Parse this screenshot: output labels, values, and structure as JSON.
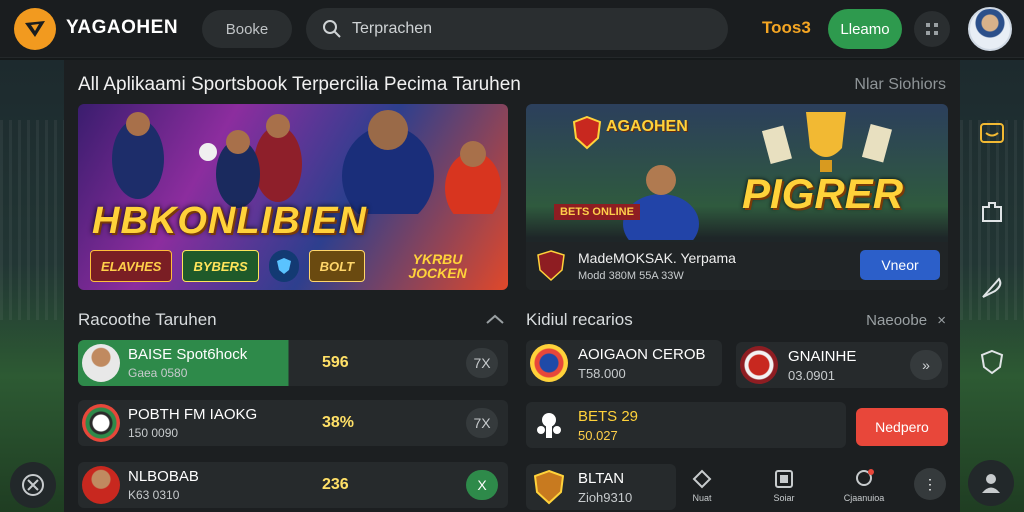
{
  "header": {
    "brand": "YAGAOHEN",
    "books_label": "Booke",
    "search_placeholder": "Terprachen",
    "odds_label": "Toos3",
    "login_label": "Lleamo"
  },
  "main": {
    "title": "All Aplikaami Sportsbook Terpercilia Pecima Taruhen",
    "top_link": "Nlar Siohiors",
    "banner_left": {
      "headline": "HBKONLIBIEN",
      "badges": [
        "ELAVHES",
        "BYBERS",
        "YKRBU JOCKEN"
      ],
      "badge_logo": "BOLT"
    },
    "banner_right": {
      "logo": "AGAOHEN",
      "headline": "PIGRER",
      "stripe": "BETS ONLINE",
      "title": "MadeMOKSAK. Yerpama",
      "subtitle": "Modd 380M 55A 33W",
      "button": "Vneor"
    },
    "left_section": {
      "title": "Racoothe Taruhen",
      "rows": [
        {
          "name": "BAISE Spot6hock",
          "sub": "Gaea 0580",
          "odds": "596",
          "action": "7X",
          "active": true
        },
        {
          "name": "POBTH FM IAOKG",
          "sub": "150 0090",
          "odds": "38%",
          "action": "7X",
          "active": false
        },
        {
          "name": "NLBOBAB",
          "sub": "K63 0310",
          "odds": "236",
          "action": "X",
          "active": false
        }
      ]
    },
    "right_section": {
      "title": "Kidiul recarios",
      "link": "Naeoobe",
      "cards": [
        {
          "name": "AOIGAON CEROB",
          "sub": "T58.000"
        },
        {
          "name": "GNAINHE",
          "sub": "03.0901"
        },
        {
          "name": "BETS 29",
          "sub": "50.027"
        },
        {
          "name": "BLTAN",
          "sub": "Zioh9310"
        }
      ],
      "register_label": "Nedpero"
    },
    "tabs": [
      {
        "label": "Nuat"
      },
      {
        "label": "Soiar"
      },
      {
        "label": "Cjaanuioa"
      }
    ]
  },
  "colors": {
    "accent_green": "#2e9a4e",
    "accent_orange": "#f29a1f",
    "odds_yellow": "#ffe067",
    "register_red": "#e8473a",
    "view_blue": "#2c5fc9"
  },
  "icons": {
    "logo": "bird-logo-icon",
    "search": "search-icon",
    "menu": "grid-menu-icon",
    "side_right": [
      "message-icon",
      "puzzle-icon",
      "feather-icon",
      "shield-icon",
      "profile-icon"
    ],
    "side_left": [
      "x-circle-icon"
    ]
  }
}
